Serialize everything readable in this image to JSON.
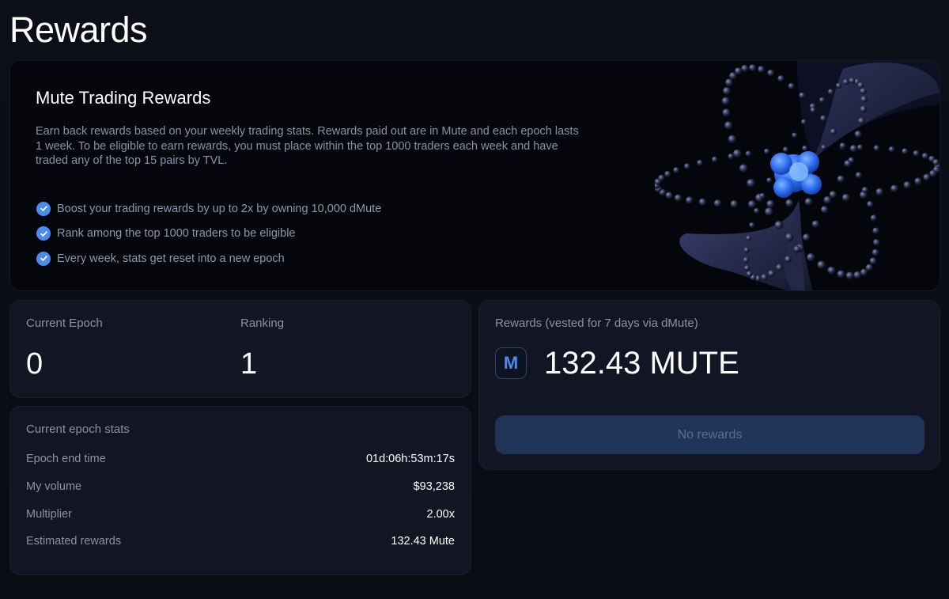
{
  "page": {
    "title": "Rewards"
  },
  "hero": {
    "title": "Mute Trading Rewards",
    "description": "Earn back rewards based on your weekly trading stats. Rewards paid out are in Mute and each epoch lasts 1 week. To be eligible to earn rewards, you must place within the top 1000 traders each week and have traded any of the top 15 pairs by TVL.",
    "benefits": [
      "Boost your trading rewards by up to 2x by owning 10,000 dMute",
      "Rank among the top 1000 traders to be eligible",
      "Every week, stats get reset into a new epoch"
    ]
  },
  "epoch": {
    "current_epoch_label": "Current Epoch",
    "current_epoch_value": "0",
    "ranking_label": "Ranking",
    "ranking_value": "1"
  },
  "stats": {
    "title": "Current epoch stats",
    "rows": [
      {
        "label": "Epoch end time",
        "value": "01d:06h:53m:17s"
      },
      {
        "label": "My volume",
        "value": "$93,238"
      },
      {
        "label": "Multiplier",
        "value": "2.00x"
      },
      {
        "label": "Estimated rewards",
        "value": "132.43 Mute"
      }
    ]
  },
  "rewards": {
    "label": "Rewards (vested for 7 days via dMute)",
    "logo_text": "M",
    "amount": "132.43 MUTE",
    "button_label": "No rewards"
  },
  "colors": {
    "accent": "#4a8cf0",
    "background": "#0a0c14",
    "card": "#121624",
    "button_disabled": "#1f3456"
  },
  "icons": {
    "benefit_bullet": "check-circle-icon",
    "token_logo": "mute-logo-icon",
    "hero_art": "orbit-illustration"
  }
}
